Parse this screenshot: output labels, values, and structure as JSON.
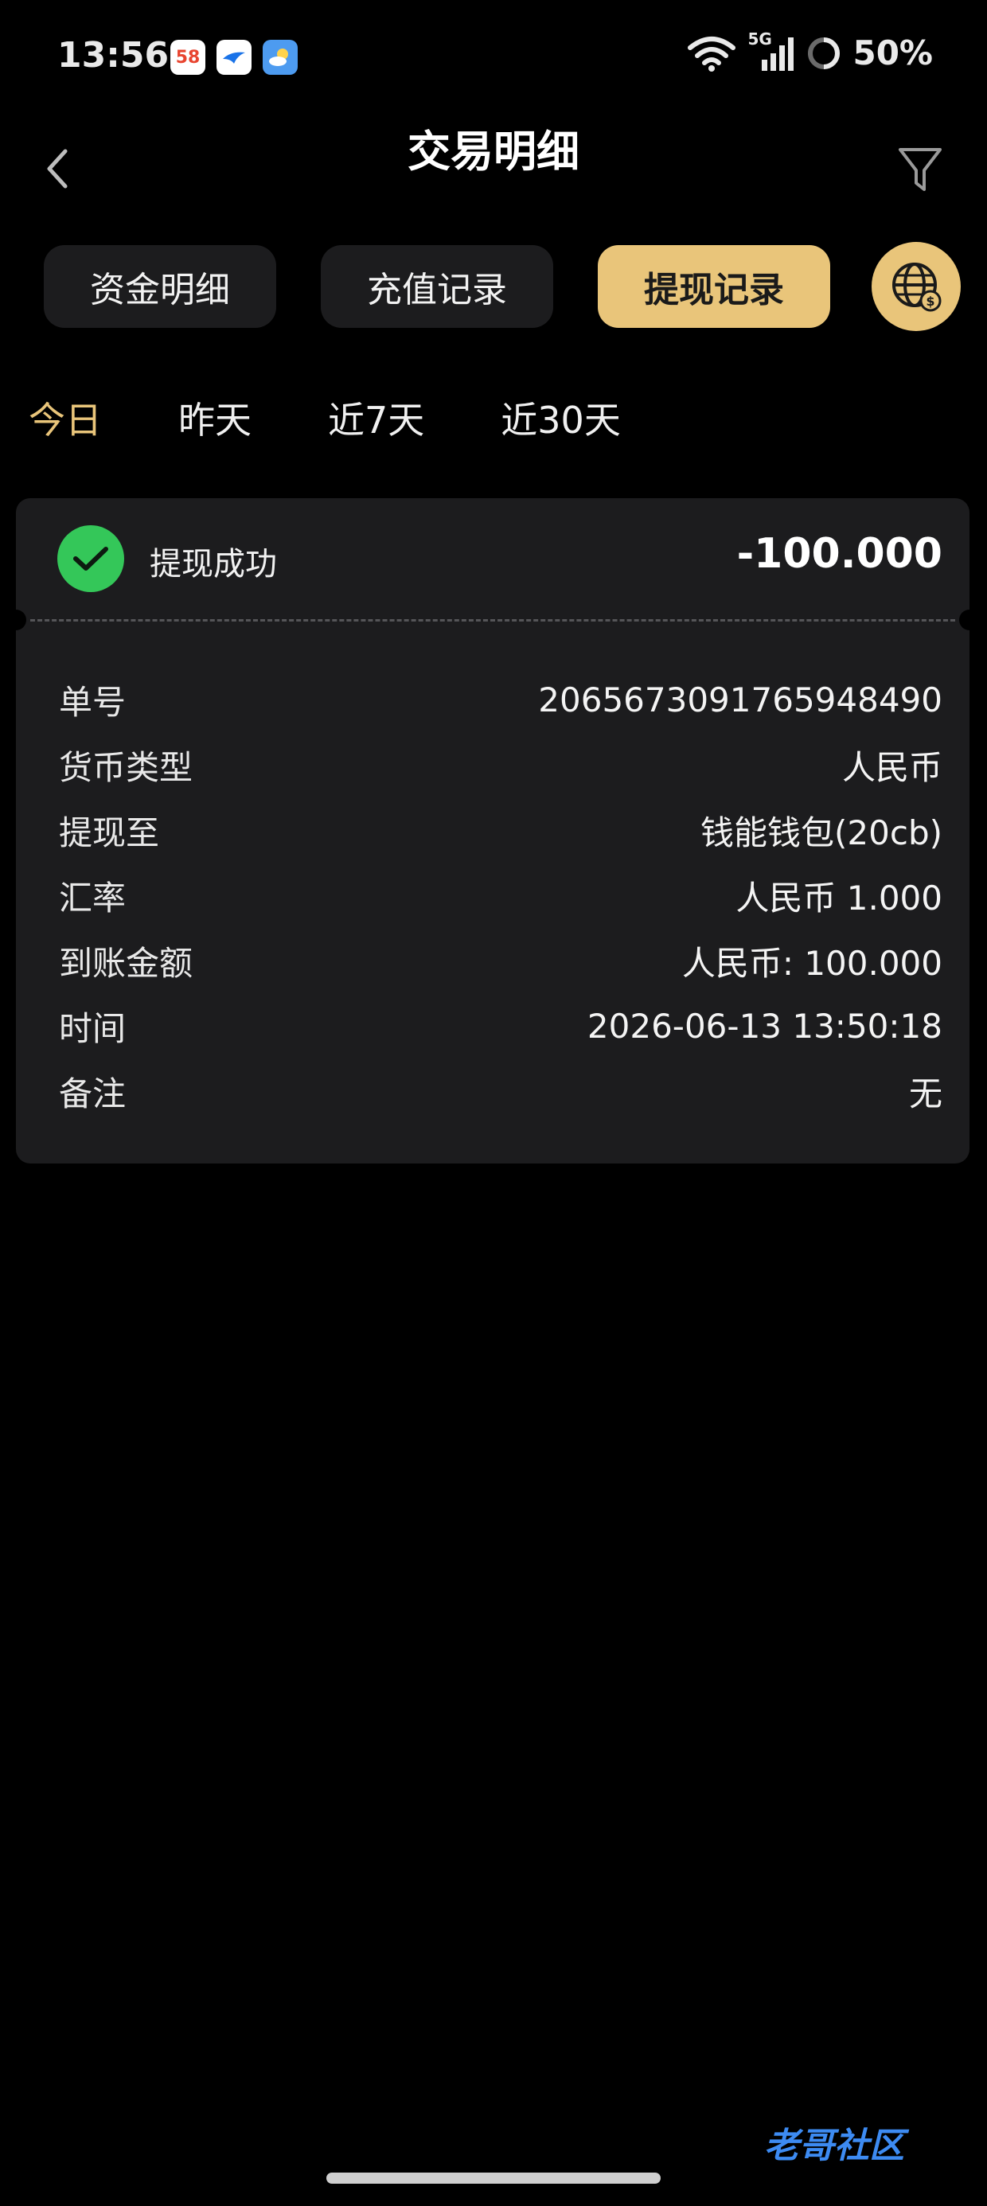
{
  "status_bar": {
    "time": "13:56",
    "apps": [
      "58",
      "bird-icon",
      "weather-icon"
    ],
    "network": "5G",
    "battery": "50%"
  },
  "nav": {
    "title": "交易明细",
    "back_icon": "chevron-left-icon",
    "filter_icon": "filter-icon"
  },
  "tabs": [
    {
      "label": "资金明细",
      "active": false
    },
    {
      "label": "充值记录",
      "active": false
    },
    {
      "label": "提现记录",
      "active": true
    }
  ],
  "globe_icon": "globe-currency-icon",
  "date_filters": [
    {
      "label": "今日",
      "active": true
    },
    {
      "label": "昨天",
      "active": false
    },
    {
      "label": "近7天",
      "active": false
    },
    {
      "label": "近30天",
      "active": false
    }
  ],
  "record": {
    "status": "提现成功",
    "amount": "-100.000",
    "details": [
      {
        "label": "单号",
        "value": "2065673091765948490"
      },
      {
        "label": "货币类型",
        "value": "人民币"
      },
      {
        "label": "提现至",
        "value": "钱能钱包(20cb)"
      },
      {
        "label": "汇率",
        "value": "人民币 1.000"
      },
      {
        "label": "到账金额",
        "value": "人民币: 100.000"
      },
      {
        "label": "时间",
        "value": "2026-06-13 13:50:18"
      },
      {
        "label": "备注",
        "value": "无"
      }
    ]
  },
  "watermark": "老哥社区",
  "colors": {
    "accent": "#e9c57a",
    "success": "#34c759",
    "card_bg": "#1c1c1e",
    "background": "#000000"
  }
}
